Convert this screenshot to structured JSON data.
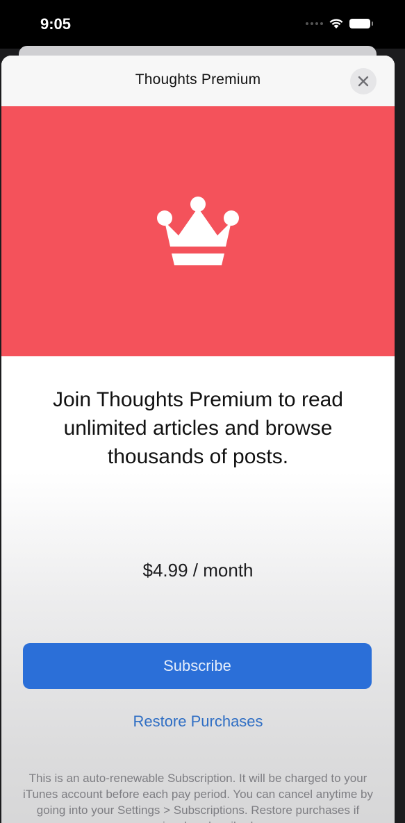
{
  "status_bar": {
    "time": "9:05"
  },
  "sheet": {
    "title": "Thoughts Premium",
    "hero_color": "#f4525b"
  },
  "content": {
    "pitch": "Join Thoughts Premium to read unlimited articles and browse thousands of posts.",
    "price": "$4.99 / month",
    "subscribe_label": "Subscribe",
    "restore_label": "Restore Purchases",
    "legal_text": "This is an auto-renewable Subscription. It will be charged to your iTunes account before each pay period. You can cancel anytime by going into your Settings > Subscriptions. Restore purchases if previously subscribed."
  },
  "icons": {
    "close": "close-icon",
    "crown": "crown-icon",
    "wifi": "wifi-icon",
    "battery": "battery-icon"
  }
}
